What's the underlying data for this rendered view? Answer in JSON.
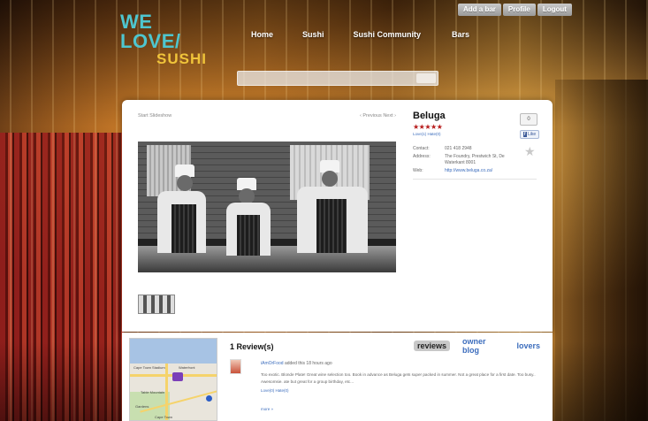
{
  "utility": {
    "add_listing": "Add a bar",
    "profile": "Profile",
    "logout": "Logout"
  },
  "logo": {
    "line1": "WE LOVE/",
    "line2": "SUSHI"
  },
  "nav": {
    "items": [
      "Home",
      "Sushi",
      "Sushi Community",
      "Bars"
    ]
  },
  "search": {
    "placeholder": "",
    "button": ""
  },
  "gallery": {
    "start_slideshow": "Start Slideshow",
    "prev_next": "‹ Previous  Next ›",
    "credit": ""
  },
  "listing": {
    "name": "Beluga",
    "rating": 5,
    "stars": "★★★★★",
    "vote": "Love(1)  Hate(0)",
    "fb_like_count": "0",
    "fb_like_label": "Like",
    "contact_label": "Contact:",
    "contact_value": "021 418 2948",
    "address_label": "Address:",
    "address_value": "The Foundry, Prestwich St, De Waterkant 8001",
    "web_label": "Web:",
    "web_value": "http://www.beluga.co.za/"
  },
  "reviews": {
    "heading": "1 Review(s)",
    "tabs": [
      "reviews",
      "owner blog",
      "lovers"
    ],
    "items": [
      {
        "user": "iAmOrFood",
        "meta_suffix": " added this 18 hours ago",
        "text": "Too exotic. Blonde Plate! Great wine selection too. Book in advance as Beluga gets super packed in summer. Not a great place for a first date. Too busy.. Awesomsie. ate but great for a group birthday, etc...",
        "vote": "Love(0)  Hate(0)"
      }
    ],
    "more": "more »"
  },
  "map": {
    "labels": [
      "Cape Town Stadium",
      "Table Mountain",
      "Waterfront",
      "Gardens",
      "Cape Town"
    ]
  },
  "colors": {
    "accent_blue": "#3c6dbd",
    "star_red": "#b71c1c",
    "logo_cyan": "#4ec6cf",
    "logo_yellow": "#f0c43a"
  }
}
